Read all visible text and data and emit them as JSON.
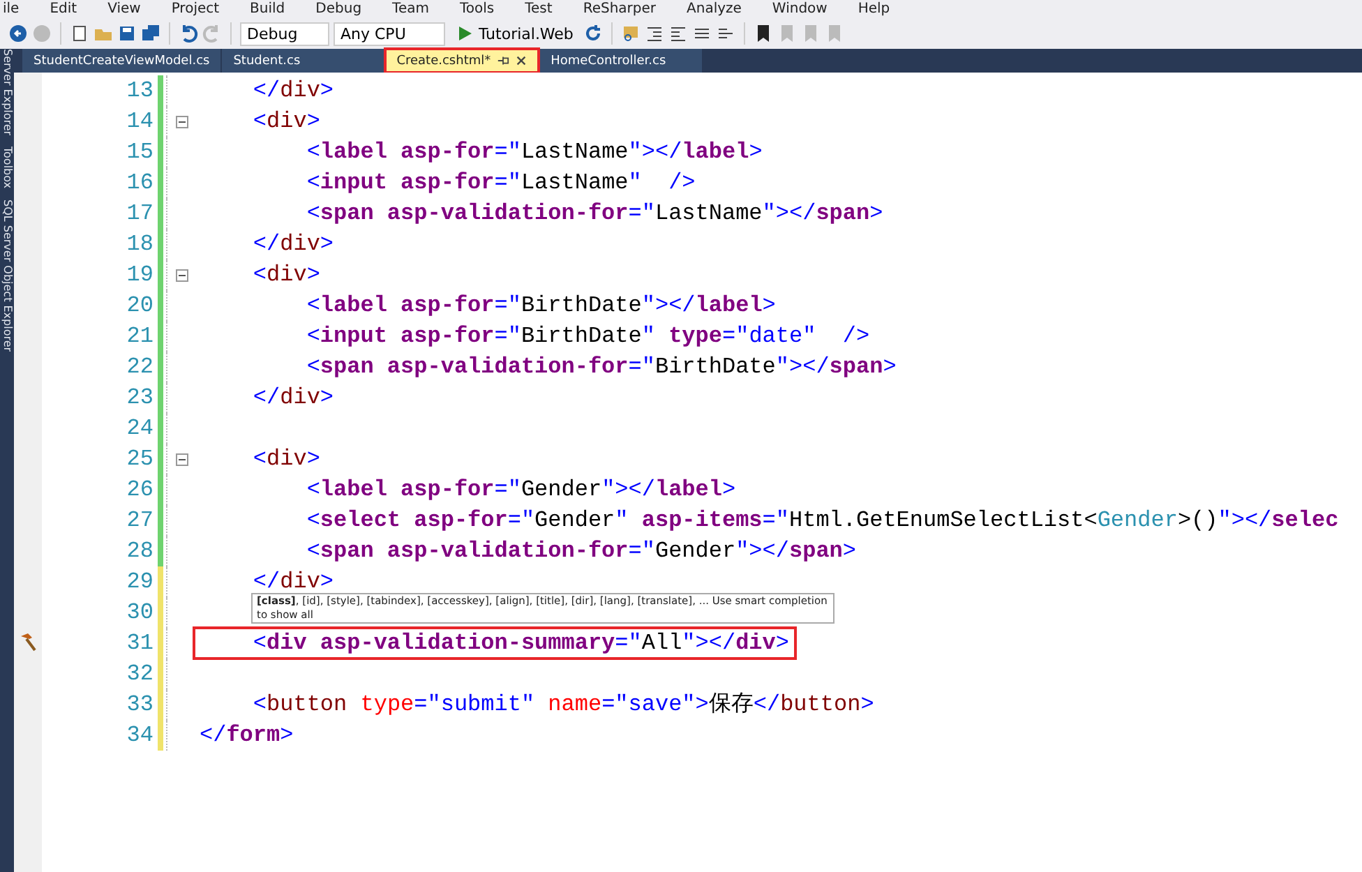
{
  "menu": [
    "ile",
    "Edit",
    "View",
    "Project",
    "Build",
    "Debug",
    "Team",
    "Tools",
    "Test",
    "ReSharper",
    "Analyze",
    "Window",
    "Help"
  ],
  "toolbar": {
    "configuration": "Debug",
    "platform": "Any CPU",
    "start": "Tutorial.Web"
  },
  "side_tabs": [
    "Server Explorer",
    "Toolbox",
    "SQL Server Object Explorer"
  ],
  "tabs": [
    {
      "label": "StudentCreateViewModel.cs",
      "selected": false,
      "annotated": false
    },
    {
      "label": "Student.cs",
      "selected": false,
      "annotated": false
    },
    {
      "label": "Create.cshtml*",
      "selected": true,
      "annotated": true
    },
    {
      "label": "HomeController.cs",
      "selected": false,
      "annotated": false
    }
  ],
  "lines": [
    {
      "number": "13",
      "color": "#6fd36f",
      "fold": false,
      "annotated": false,
      "tokens": [
        {
          "kind": "punct",
          "text": "    </"
        },
        {
          "kind": "tag",
          "text": "div"
        },
        {
          "kind": "punct",
          "text": ">"
        }
      ]
    },
    {
      "number": "14",
      "color": "#6fd36f",
      "fold": true,
      "annotated": false,
      "tokens": [
        {
          "kind": "punct",
          "text": "    <"
        },
        {
          "kind": "tag",
          "text": "div"
        },
        {
          "kind": "punct",
          "text": ">"
        }
      ]
    },
    {
      "number": "15",
      "color": "#6fd36f",
      "fold": false,
      "annotated": false,
      "tokens": [
        {
          "kind": "punct",
          "text": "        <"
        },
        {
          "kind": "helper",
          "text": "label asp-for"
        },
        {
          "kind": "punct",
          "text": "=\""
        },
        {
          "kind": "text",
          "text": "LastName"
        },
        {
          "kind": "punct",
          "text": "\"></"
        },
        {
          "kind": "helper",
          "text": "label"
        },
        {
          "kind": "punct",
          "text": ">"
        }
      ]
    },
    {
      "number": "16",
      "color": "#6fd36f",
      "fold": false,
      "annotated": false,
      "tokens": [
        {
          "kind": "punct",
          "text": "        <"
        },
        {
          "kind": "helper",
          "text": "input asp-for"
        },
        {
          "kind": "punct",
          "text": "=\""
        },
        {
          "kind": "text",
          "text": "LastName"
        },
        {
          "kind": "punct",
          "text": "\"  />"
        }
      ]
    },
    {
      "number": "17",
      "color": "#6fd36f",
      "fold": false,
      "annotated": false,
      "tokens": [
        {
          "kind": "punct",
          "text": "        <"
        },
        {
          "kind": "helper",
          "text": "span asp-validation-for"
        },
        {
          "kind": "punct",
          "text": "=\""
        },
        {
          "kind": "text",
          "text": "LastName"
        },
        {
          "kind": "punct",
          "text": "\"></"
        },
        {
          "kind": "helper",
          "text": "span"
        },
        {
          "kind": "punct",
          "text": ">"
        }
      ]
    },
    {
      "number": "18",
      "color": "#6fd36f",
      "fold": false,
      "annotated": false,
      "tokens": [
        {
          "kind": "punct",
          "text": "    </"
        },
        {
          "kind": "tag",
          "text": "div"
        },
        {
          "kind": "punct",
          "text": ">"
        }
      ]
    },
    {
      "number": "19",
      "color": "#6fd36f",
      "fold": true,
      "annotated": false,
      "tokens": [
        {
          "kind": "punct",
          "text": "    <"
        },
        {
          "kind": "tag",
          "text": "div"
        },
        {
          "kind": "punct",
          "text": ">"
        }
      ]
    },
    {
      "number": "20",
      "color": "#6fd36f",
      "fold": false,
      "annotated": false,
      "tokens": [
        {
          "kind": "punct",
          "text": "        <"
        },
        {
          "kind": "helper",
          "text": "label asp-for"
        },
        {
          "kind": "punct",
          "text": "=\""
        },
        {
          "kind": "text",
          "text": "BirthDate"
        },
        {
          "kind": "punct",
          "text": "\"></"
        },
        {
          "kind": "helper",
          "text": "label"
        },
        {
          "kind": "punct",
          "text": ">"
        }
      ]
    },
    {
      "number": "21",
      "color": "#6fd36f",
      "fold": false,
      "annotated": false,
      "tokens": [
        {
          "kind": "punct",
          "text": "        <"
        },
        {
          "kind": "helper",
          "text": "input asp-for"
        },
        {
          "kind": "punct",
          "text": "=\""
        },
        {
          "kind": "text",
          "text": "BirthDate"
        },
        {
          "kind": "punct",
          "text": "\" "
        },
        {
          "kind": "helper",
          "text": "type"
        },
        {
          "kind": "punct",
          "text": "=\""
        },
        {
          "kind": "attrval",
          "text": "date"
        },
        {
          "kind": "punct",
          "text": "\"  />"
        }
      ]
    },
    {
      "number": "22",
      "color": "#6fd36f",
      "fold": false,
      "annotated": false,
      "tokens": [
        {
          "kind": "punct",
          "text": "        <"
        },
        {
          "kind": "helper",
          "text": "span asp-validation-for"
        },
        {
          "kind": "punct",
          "text": "=\""
        },
        {
          "kind": "text",
          "text": "BirthDate"
        },
        {
          "kind": "punct",
          "text": "\"></"
        },
        {
          "kind": "helper",
          "text": "span"
        },
        {
          "kind": "punct",
          "text": ">"
        }
      ]
    },
    {
      "number": "23",
      "color": "#6fd36f",
      "fold": false,
      "annotated": false,
      "tokens": [
        {
          "kind": "punct",
          "text": "    </"
        },
        {
          "kind": "tag",
          "text": "div"
        },
        {
          "kind": "punct",
          "text": ">"
        }
      ]
    },
    {
      "number": "24",
      "color": "#6fd36f",
      "fold": false,
      "annotated": false
    },
    {
      "number": "25",
      "color": "#6fd36f",
      "fold": true,
      "annotated": false,
      "tokens": [
        {
          "kind": "punct",
          "text": "    <"
        },
        {
          "kind": "tag",
          "text": "div"
        },
        {
          "kind": "punct",
          "text": ">"
        }
      ]
    },
    {
      "number": "26",
      "color": "#6fd36f",
      "fold": false,
      "annotated": false,
      "tokens": [
        {
          "kind": "punct",
          "text": "        <"
        },
        {
          "kind": "helper",
          "text": "label asp-for"
        },
        {
          "kind": "punct",
          "text": "=\""
        },
        {
          "kind": "text",
          "text": "Gender"
        },
        {
          "kind": "punct",
          "text": "\"></"
        },
        {
          "kind": "helper",
          "text": "label"
        },
        {
          "kind": "punct",
          "text": ">"
        }
      ]
    },
    {
      "number": "27",
      "color": "#6fd36f",
      "fold": false,
      "annotated": false,
      "tokens": [
        {
          "kind": "punct",
          "text": "        <"
        },
        {
          "kind": "helper",
          "text": "select asp-for"
        },
        {
          "kind": "punct",
          "text": "=\""
        },
        {
          "kind": "text",
          "text": "Gender"
        },
        {
          "kind": "punct",
          "text": "\" "
        },
        {
          "kind": "helper",
          "text": "asp-items"
        },
        {
          "kind": "punct",
          "text": "=\""
        },
        {
          "kind": "text",
          "text": "Html.GetEnumSelectList<"
        },
        {
          "kind": "type",
          "text": "Gender"
        },
        {
          "kind": "text",
          "text": ">()"
        },
        {
          "kind": "punct",
          "text": "\"></"
        },
        {
          "kind": "helper",
          "text": "selec"
        }
      ]
    },
    {
      "number": "28",
      "color": "#6fd36f",
      "fold": false,
      "annotated": false,
      "tokens": [
        {
          "kind": "punct",
          "text": "        <"
        },
        {
          "kind": "helper",
          "text": "span asp-validation-for"
        },
        {
          "kind": "punct",
          "text": "=\""
        },
        {
          "kind": "text",
          "text": "Gender"
        },
        {
          "kind": "punct",
          "text": "\"></"
        },
        {
          "kind": "helper",
          "text": "span"
        },
        {
          "kind": "punct",
          "text": ">"
        }
      ]
    },
    {
      "number": "29",
      "color": "#f0e36a",
      "fold": false,
      "annotated": false,
      "tokens": [
        {
          "kind": "punct",
          "text": "    </"
        },
        {
          "kind": "tag",
          "text": "div"
        },
        {
          "kind": "punct",
          "text": ">"
        }
      ]
    },
    {
      "number": "30",
      "color": "#f0e36a",
      "fold": false,
      "annotated": false
    },
    {
      "number": "31",
      "color": "#f0e36a",
      "fold": false,
      "annotated": true,
      "tokens": [
        {
          "kind": "punct",
          "text": "    <"
        },
        {
          "kind": "helper",
          "text": "div asp-validation-summary"
        },
        {
          "kind": "punct",
          "text": "=\""
        },
        {
          "kind": "text",
          "text": "All"
        },
        {
          "kind": "punct",
          "text": "\"></"
        },
        {
          "kind": "helper",
          "text": "div"
        },
        {
          "kind": "punct",
          "text": ">"
        }
      ]
    },
    {
      "number": "32",
      "color": "#f0e36a",
      "fold": false,
      "annotated": false
    },
    {
      "number": "33",
      "color": "#f0e36a",
      "fold": false,
      "annotated": false,
      "tokens": [
        {
          "kind": "punct",
          "text": "    <"
        },
        {
          "kind": "tag",
          "text": "button "
        },
        {
          "kind": "attr",
          "text": "type"
        },
        {
          "kind": "punct",
          "text": "=\""
        },
        {
          "kind": "attrval",
          "text": "submit"
        },
        {
          "kind": "punct",
          "text": "\" "
        },
        {
          "kind": "attr",
          "text": "name"
        },
        {
          "kind": "punct",
          "text": "=\""
        },
        {
          "kind": "attrval",
          "text": "save"
        },
        {
          "kind": "punct",
          "text": "\">"
        },
        {
          "kind": "text",
          "text": "保存"
        },
        {
          "kind": "punct",
          "text": "</"
        },
        {
          "kind": "tag",
          "text": "button"
        },
        {
          "kind": "punct",
          "text": ">"
        }
      ]
    },
    {
      "number": "34",
      "color": "#f0e36a",
      "fold": false,
      "annotated": false,
      "tokens": [
        {
          "kind": "punct",
          "text": "</"
        },
        {
          "kind": "helper",
          "text": "form"
        },
        {
          "kind": "punct",
          "text": ">"
        }
      ]
    }
  ],
  "tooltip": "**[class]**, [id], [style], [tabindex], [accesskey], [align], [title], [dir], [lang], [translate], ... Use smart completion to show all"
}
